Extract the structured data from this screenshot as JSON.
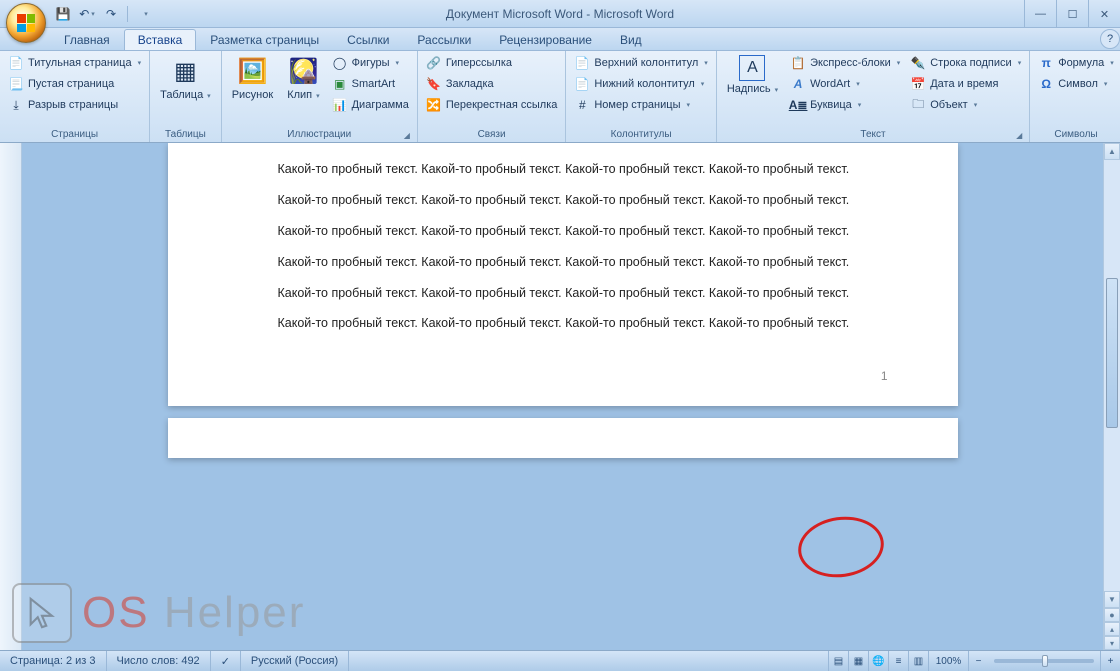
{
  "title": "Документ Microsoft Word - Microsoft Word",
  "tabs": [
    "Главная",
    "Вставка",
    "Разметка страницы",
    "Ссылки",
    "Рассылки",
    "Рецензирование",
    "Вид"
  ],
  "active_tab": 1,
  "ribbon": {
    "pages": {
      "label": "Страницы",
      "title_page": "Титульная страница",
      "blank_page": "Пустая страница",
      "page_break": "Разрыв страницы"
    },
    "tables": {
      "label": "Таблицы",
      "table": "Таблица"
    },
    "illustrations": {
      "label": "Иллюстрации",
      "picture": "Рисунок",
      "clip": "Клип",
      "shapes": "Фигуры",
      "smartart": "SmartArt",
      "chart": "Диаграмма"
    },
    "links": {
      "label": "Связи",
      "hyperlink": "Гиперссылка",
      "bookmark": "Закладка",
      "crossref": "Перекрестная ссылка"
    },
    "headerfooter": {
      "label": "Колонтитулы",
      "header": "Верхний колонтитул",
      "footer": "Нижний колонтитул",
      "pagenum": "Номер страницы"
    },
    "text": {
      "label": "Текст",
      "textbox": "Надпись",
      "quickparts": "Экспресс-блоки",
      "wordart": "WordArt",
      "dropcap": "Буквица",
      "sigline": "Строка подписи",
      "datetime": "Дата и время",
      "object": "Объект"
    },
    "symbols": {
      "label": "Символы",
      "equation": "Формула",
      "symbol": "Символ"
    }
  },
  "doc_paragraph": "Какой-то пробный текст. Какой-то пробный текст. Какой-то пробный текст. Какой-то пробный текст.",
  "page_number": "1",
  "status": {
    "page": "Страница: 2 из 3",
    "words": "Число слов: 492",
    "lang": "Русский (Россия)",
    "zoom": "100%"
  },
  "watermark": {
    "os": "OS",
    "help": "Helper"
  }
}
